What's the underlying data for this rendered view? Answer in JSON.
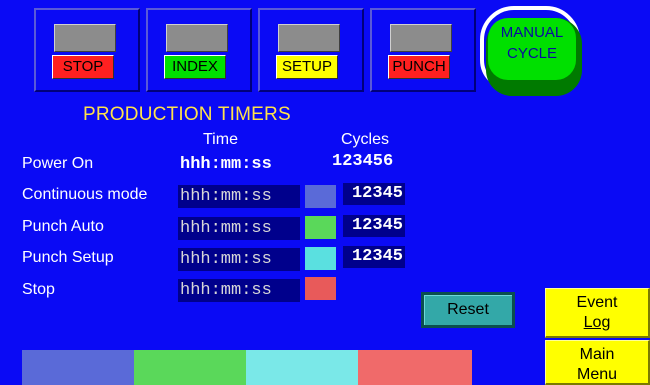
{
  "mode_buttons": [
    {
      "label": "STOP",
      "label_bg": "#ff2020",
      "label_color": "#000000"
    },
    {
      "label": "INDEX",
      "label_bg": "#00e000",
      "label_color": "#000000"
    },
    {
      "label": "SETUP",
      "label_bg": "#ffff00",
      "label_color": "#000000"
    },
    {
      "label": "PUNCH",
      "label_bg": "#ff2020",
      "label_color": "#000000"
    }
  ],
  "manual_cycle": {
    "label": "MANUAL\nCYCLE",
    "color": "#00e000"
  },
  "timers": {
    "title": "PRODUCTION TIMERS",
    "time_header": "Time",
    "cycles_header": "Cycles",
    "rows": [
      {
        "label": "Power On",
        "time": "hhh:mm:ss",
        "cycles": "123456",
        "color": ""
      },
      {
        "label": "Continuous mode",
        "time": "hhh:mm:ss",
        "cycles": "12345",
        "color": "#5a6ad8"
      },
      {
        "label": "Punch Auto",
        "time": "hhh:mm:ss",
        "cycles": "12345",
        "color": "#5ad85a"
      },
      {
        "label": "Punch Setup",
        "time": "hhh:mm:ss",
        "cycles": "12345",
        "color": "#5ae0e0"
      },
      {
        "label": "Stop",
        "time": "hhh:mm:ss",
        "cycles": "",
        "color": "#e85a5a"
      }
    ]
  },
  "reset_button": {
    "label": "Reset"
  },
  "event_log_button": {
    "line1": "Event",
    "line2": "Log"
  },
  "main_menu_button": {
    "line1": "Main",
    "line2": "Menu"
  },
  "bottom_bar_colors": [
    "#5a6ad8",
    "#5ad85a",
    "#7ae8e8",
    "#f06a6a"
  ]
}
